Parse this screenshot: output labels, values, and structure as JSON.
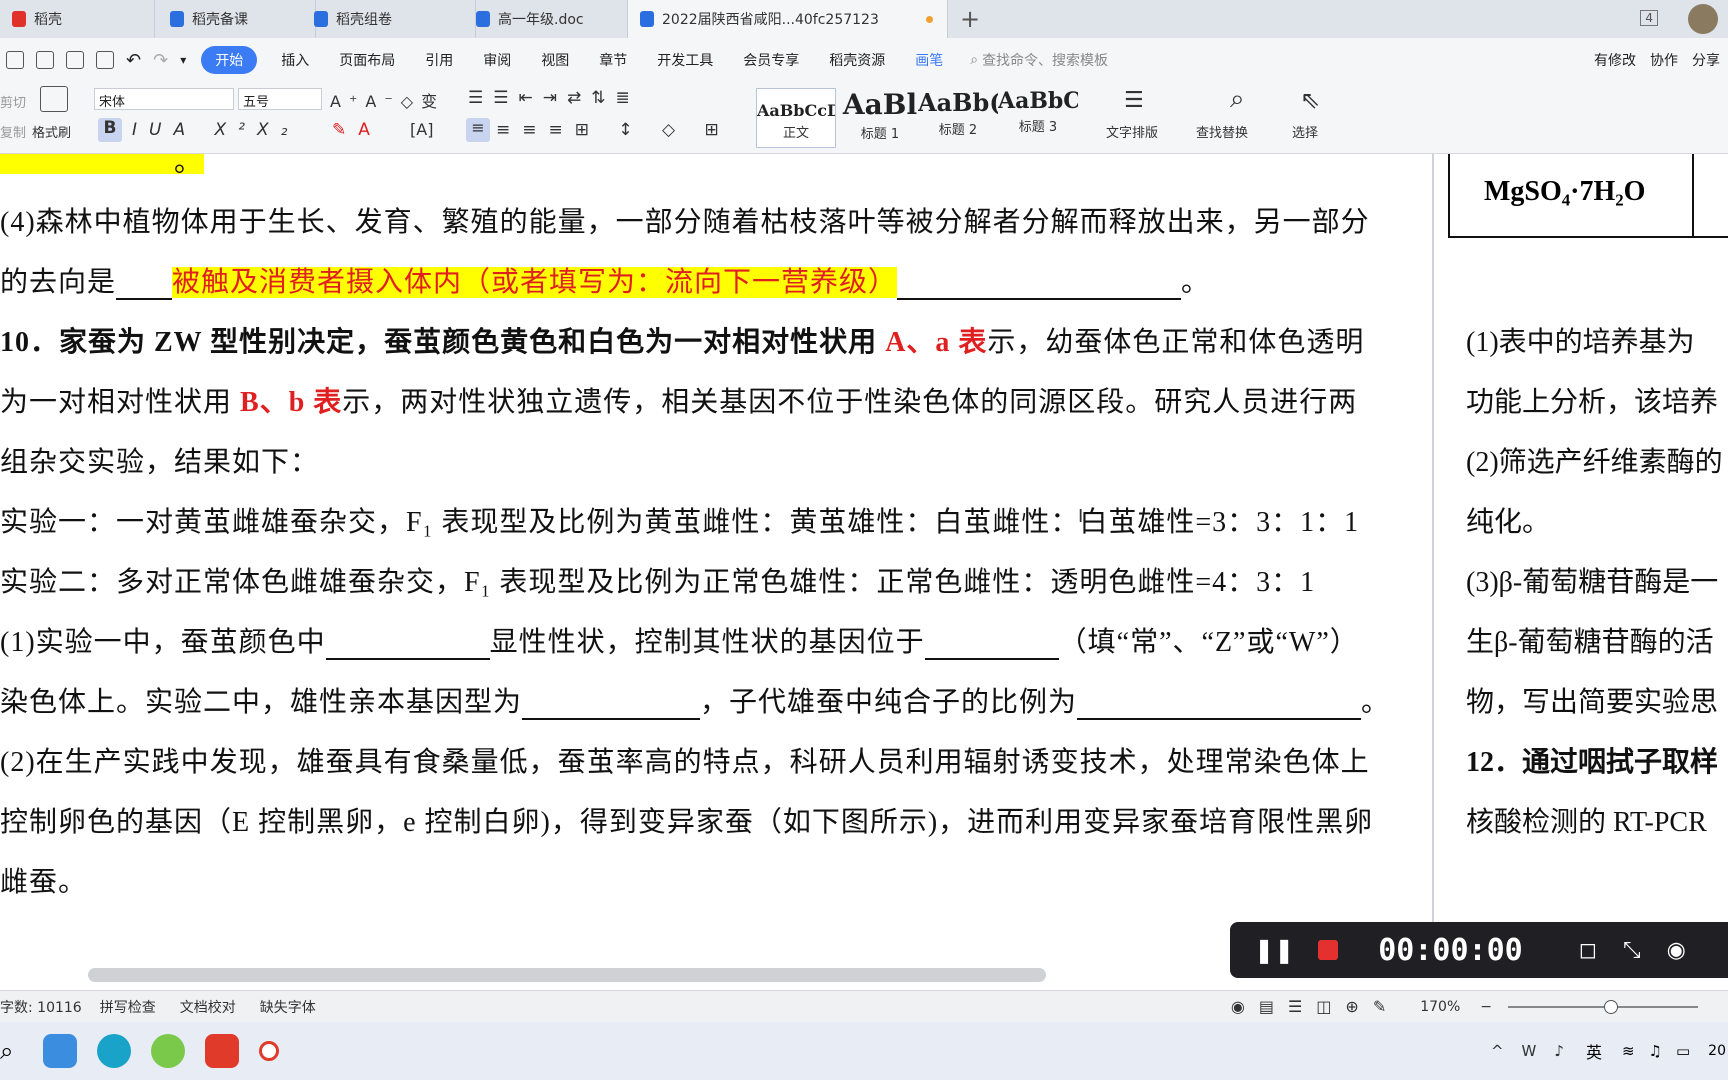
{
  "tabs": [
    {
      "label": "稻壳",
      "color": "#e0302a"
    },
    {
      "label": "稻壳备课",
      "color": "#2a6ee0"
    },
    {
      "label": "稻壳组卷",
      "color": "#2a6ee0"
    },
    {
      "label": "高一年级.doc",
      "color": "#2a6ee0"
    },
    {
      "label": "2022届陕西省咸阳...40fc257123",
      "color": "#2a6ee0"
    }
  ],
  "tab_counter": "4",
  "menu": {
    "items": [
      "开始",
      "插入",
      "页面布局",
      "引用",
      "审阅",
      "视图",
      "章节",
      "开发工具",
      "会员专享",
      "稻壳资源"
    ],
    "pen": "画笔",
    "search_placeholder": "查找命令、搜索模板",
    "modified": "有修改",
    "collab": "协作",
    "share": "分享"
  },
  "ribbon": {
    "cut": "剪切",
    "copy": "复制",
    "format_painter": "格式刷",
    "font": "宋体",
    "size": "五号",
    "styles": [
      {
        "preview": "AaBbCcDd",
        "label": "正文"
      },
      {
        "preview": "AaBl",
        "label": "标题 1"
      },
      {
        "preview": "AaBb(",
        "label": "标题 2"
      },
      {
        "preview": "AaBbC",
        "label": "标题 3"
      }
    ],
    "text_layout": "文字排版",
    "find_replace": "查找替换",
    "select": "选择"
  },
  "doc": {
    "l0": "。",
    "l1": "(4)森林中植物体用于生长、发育、繁殖的能量，一部分随着枯枝落叶等被分解者分解而释放出来，另一部分",
    "l2a": "的去向是",
    "l2hl": "被触及消费者摄入体内（或者填写为：流向下一营养级）",
    "l2end": "。",
    "l3a": "10．家蚕为 ZW 型性别决定，蚕茧颜色黄色和白色为一对相对性状用 ",
    "l3red": "A、a 表",
    "l3b": "示，幼蚕体色正常和体色透明",
    "l4a": "为一对相对性状用 ",
    "l4red": "B、b 表",
    "l4b": "示，两对性状独立遗传，相关基因不位于性染色体的同源区段。研究人员进行两",
    "l5": "组杂交实验，结果如下：",
    "l6": "实验一：一对黄茧雌雄蚕杂交，F₁ 表现型及比例为黄茧雌性：黄茧雄性：白茧雌性：白茧雄性=3：3：1：1",
    "l7": "实验二：多对正常体色雌雄蚕杂交，F₁ 表现型及比例为正常色雄性：正常色雌性：透明色雌性=4：3：1",
    "l8a": "(1)实验一中，蚕茧颜色中",
    "l8b": "显性性状，控制其性状的基因位于",
    "l8c": "（填“常”、“Z”或“W”）",
    "l9a": "染色体上。实验二中，雄性亲本基因型为",
    "l9b": "，子代雄蚕中纯合子的比例为",
    "l9c": "。",
    "l10": "(2)在生产实践中发现，雄蚕具有食桑量低，蚕茧率高的特点，科研人员利用辐射诱变技术，处理常染色体上",
    "l11": "控制卵色的基因（E 控制黑卵，e 控制白卵)，得到变异家蚕（如下图所示)，进而利用变异家蚕培育限性黑卵",
    "l12": "雌蚕。"
  },
  "right": {
    "formula": "MgSO₄·7H₂O",
    "r1": "(1)表中的培养基为",
    "r2": "功能上分析，该培养",
    "r3": "(2)筛选产纤维素酶的",
    "r4": "纯化。",
    "r5": "(3)β-葡萄糖苷酶是一",
    "r6": "生β-葡萄糖苷酶的活",
    "r7": "物，写出简要实验思",
    "r8": "12．通过咽拭子取样",
    "r9": "核酸检测的 RT-PCR"
  },
  "recorder": {
    "time": "00:00:00"
  },
  "status": {
    "word_count": "字数: 10116",
    "spell": "拼写检查",
    "proof": "文档校对",
    "missing_font": "缺失字体",
    "zoom": "170%"
  },
  "taskbar": {
    "ime": "英",
    "clock": "20"
  }
}
